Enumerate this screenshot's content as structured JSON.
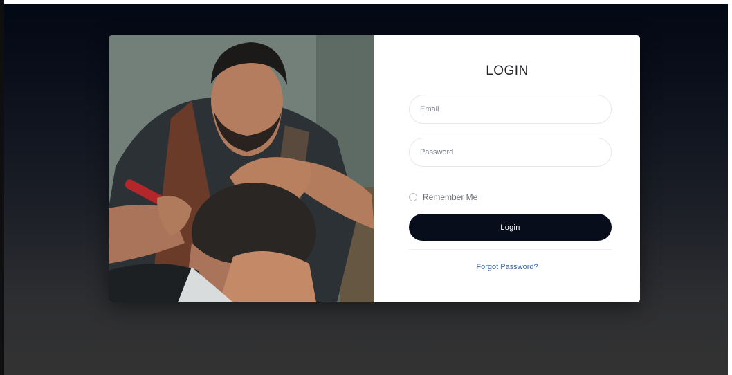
{
  "login": {
    "title": "LOGIN",
    "email_placeholder": "Email",
    "password_placeholder": "Password",
    "remember_label": "Remember Me",
    "remember_checked": false,
    "login_button": "Login",
    "forgot_link": "Forgot Password?"
  },
  "colors": {
    "button_bg": "#070d1a",
    "link": "#3b63a8"
  }
}
